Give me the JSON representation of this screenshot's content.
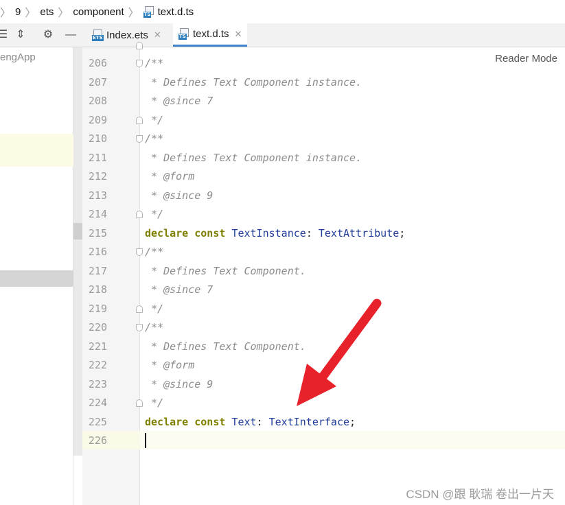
{
  "breadcrumb": {
    "items": [
      "9",
      "ets",
      "component",
      "text.d.ts"
    ]
  },
  "tabs": [
    {
      "label": "Index.ets",
      "icon": "ets-file-icon",
      "active": false
    },
    {
      "label": "text.d.ts",
      "icon": "ts-file-icon",
      "active": true
    }
  ],
  "file_icon_tag": {
    "ets": "ETS",
    "ts": "TS"
  },
  "close_glyph": "✕",
  "project_panel": {
    "label": "engApp"
  },
  "editor": {
    "reader_mode": "Reader Mode",
    "lines": [
      {
        "num": "206",
        "tokens": [
          {
            "t": "/**",
            "c": "comment"
          }
        ]
      },
      {
        "num": "207",
        "tokens": [
          {
            "t": " * Defines Text Component instance.",
            "c": "comment"
          }
        ]
      },
      {
        "num": "208",
        "tokens": [
          {
            "t": " * @since 7",
            "c": "comment"
          }
        ]
      },
      {
        "num": "209",
        "tokens": [
          {
            "t": " */",
            "c": "comment"
          }
        ]
      },
      {
        "num": "210",
        "tokens": [
          {
            "t": "/**",
            "c": "comment"
          }
        ]
      },
      {
        "num": "211",
        "tokens": [
          {
            "t": " * Defines Text Component instance.",
            "c": "comment"
          }
        ]
      },
      {
        "num": "212",
        "tokens": [
          {
            "t": " * @form",
            "c": "comment"
          }
        ]
      },
      {
        "num": "213",
        "tokens": [
          {
            "t": " * @since 9",
            "c": "comment"
          }
        ]
      },
      {
        "num": "214",
        "tokens": [
          {
            "t": " */",
            "c": "comment"
          }
        ]
      },
      {
        "num": "215",
        "tokens": [
          {
            "t": "declare",
            "c": "kw"
          },
          {
            "t": " ",
            "c": "plain"
          },
          {
            "t": "const",
            "c": "kw"
          },
          {
            "t": " TextInstance",
            "c": "type"
          },
          {
            "t": ": ",
            "c": "plain"
          },
          {
            "t": "TextAttribute",
            "c": "type"
          },
          {
            "t": ";",
            "c": "plain"
          }
        ]
      },
      {
        "num": "216",
        "tokens": [
          {
            "t": "/**",
            "c": "comment"
          }
        ]
      },
      {
        "num": "217",
        "tokens": [
          {
            "t": " * Defines Text Component.",
            "c": "comment"
          }
        ]
      },
      {
        "num": "218",
        "tokens": [
          {
            "t": " * @since 7",
            "c": "comment"
          }
        ]
      },
      {
        "num": "219",
        "tokens": [
          {
            "t": " */",
            "c": "comment"
          }
        ]
      },
      {
        "num": "220",
        "tokens": [
          {
            "t": "/**",
            "c": "comment"
          }
        ]
      },
      {
        "num": "221",
        "tokens": [
          {
            "t": " * Defines Text Component.",
            "c": "comment"
          }
        ]
      },
      {
        "num": "222",
        "tokens": [
          {
            "t": " * @form",
            "c": "comment"
          }
        ]
      },
      {
        "num": "223",
        "tokens": [
          {
            "t": " * @since 9",
            "c": "comment"
          }
        ]
      },
      {
        "num": "224",
        "tokens": [
          {
            "t": " */",
            "c": "comment"
          }
        ]
      },
      {
        "num": "225",
        "tokens": [
          {
            "t": "declare",
            "c": "kw"
          },
          {
            "t": " ",
            "c": "plain"
          },
          {
            "t": "const",
            "c": "kw"
          },
          {
            "t": " Text",
            "c": "type"
          },
          {
            "t": ": ",
            "c": "plain"
          },
          {
            "t": "TextInterface",
            "c": "type"
          },
          {
            "t": ";",
            "c": "plain"
          }
        ]
      },
      {
        "num": "226",
        "tokens": []
      }
    ]
  },
  "annotation": {
    "arrow_color": "#e8222a"
  },
  "watermark": "CSDN @跟 耿瑞 卷出一片天",
  "colors": {
    "comment": "#8c8c8c",
    "keyword": "#808000",
    "type": "#1f3c9b",
    "active_tab_underline": "#4083c9"
  }
}
